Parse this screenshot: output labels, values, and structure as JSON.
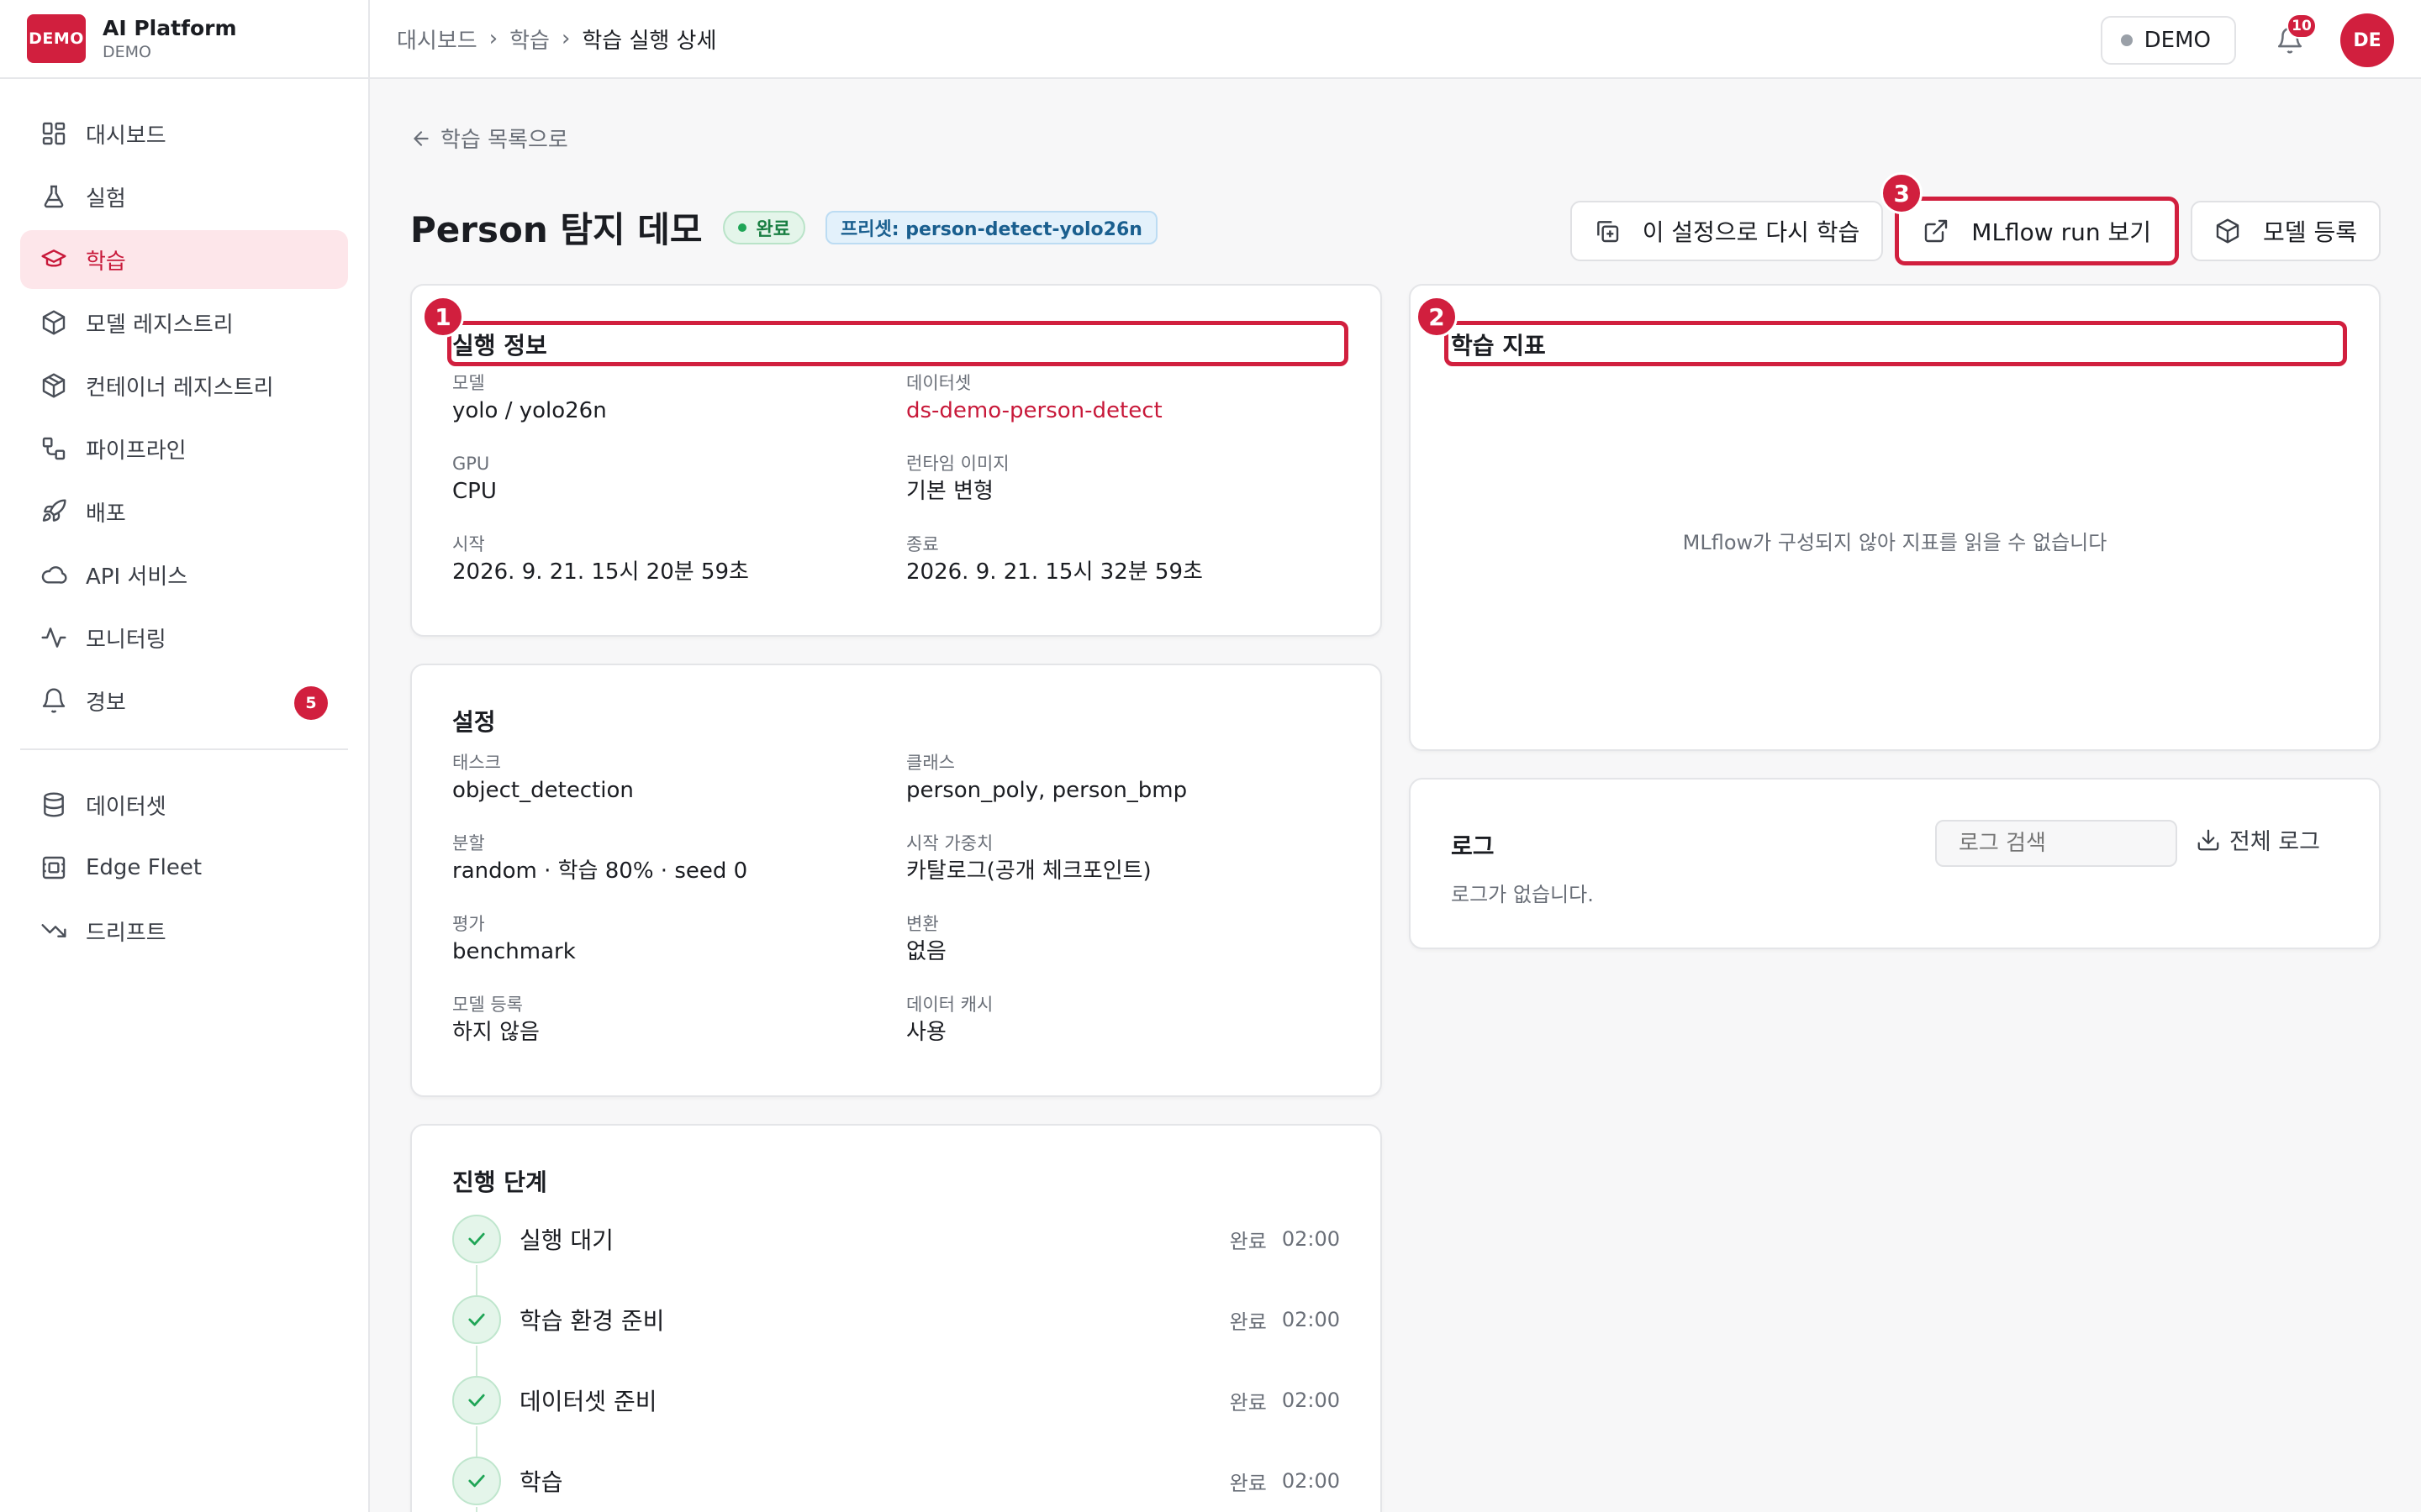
{
  "brand": {
    "logo": "DEMO",
    "name": "AI Platform",
    "sub": "DEMO"
  },
  "sidebar": {
    "items": [
      {
        "label": "대시보드",
        "icon": "dashboard-icon"
      },
      {
        "label": "실험",
        "icon": "flask-icon"
      },
      {
        "label": "학습",
        "icon": "graduation-cap-icon",
        "active": true
      },
      {
        "label": "모델 레지스트리",
        "icon": "cube-icon"
      },
      {
        "label": "컨테이너 레지스트리",
        "icon": "container-icon"
      },
      {
        "label": "파이프라인",
        "icon": "pipeline-icon"
      },
      {
        "label": "배포",
        "icon": "rocket-icon"
      },
      {
        "label": "API 서비스",
        "icon": "cloud-icon"
      },
      {
        "label": "모니터링",
        "icon": "activity-icon"
      },
      {
        "label": "경보",
        "icon": "bell-icon",
        "badge": "5"
      }
    ],
    "items2": [
      {
        "label": "데이터셋",
        "icon": "database-icon"
      },
      {
        "label": "Edge Fleet",
        "icon": "edge-device-icon"
      },
      {
        "label": "드리프트",
        "icon": "trend-down-icon"
      }
    ]
  },
  "topbar": {
    "breadcrumb": [
      "대시보드",
      "학습",
      "학습 실행 상세"
    ],
    "env_label": "DEMO",
    "notification_count": "10",
    "avatar_initials": "DE"
  },
  "page": {
    "back_label": "학습 목록으로",
    "title": "Person 탐지 데모",
    "status": "완료",
    "preset": "프리셋: person-detect-yolo26n",
    "actions": {
      "rerun": "이 설정으로 다시 학습",
      "mlflow": "MLflow run 보기",
      "register": "모델 등록"
    },
    "markers": {
      "m1": "1",
      "m2": "2",
      "m3": "3"
    }
  },
  "run_info": {
    "title": "실행 정보",
    "fields": [
      {
        "label": "모델",
        "value": "yolo / yolo26n"
      },
      {
        "label": "데이터셋",
        "value": "ds-demo-person-detect"
      },
      {
        "label": "GPU",
        "value": "CPU"
      },
      {
        "label": "런타임 이미지",
        "value": "기본 변형"
      },
      {
        "label": "시작",
        "value": "2026. 9. 21. 15시 20분 59초"
      },
      {
        "label": "종료",
        "value": "2026. 9. 21. 15시 32분 59초"
      }
    ]
  },
  "settings": {
    "title": "설정",
    "fields": [
      {
        "label": "태스크",
        "value": "object_detection"
      },
      {
        "label": "클래스",
        "value": "person_poly, person_bmp"
      },
      {
        "label": "분할",
        "value": "random · 학습 80% · seed 0"
      },
      {
        "label": "시작 가중치",
        "value": "카탈로그(공개 체크포인트)"
      },
      {
        "label": "평가",
        "value": "benchmark"
      },
      {
        "label": "변환",
        "value": "없음"
      },
      {
        "label": "모델 등록",
        "value": "하지 않음"
      },
      {
        "label": "데이터 캐시",
        "value": "사용"
      }
    ]
  },
  "steps": {
    "title": "진행 단계",
    "items": [
      {
        "name": "실행 대기",
        "status": "완료",
        "time": "02:00"
      },
      {
        "name": "학습 환경 준비",
        "status": "완료",
        "time": "02:00"
      },
      {
        "name": "데이터셋 준비",
        "status": "완료",
        "time": "02:00"
      },
      {
        "name": "학습",
        "status": "완료",
        "time": "02:00"
      }
    ]
  },
  "metrics": {
    "title": "학습 지표",
    "empty": "MLflow가 구성되지 않아 지표를 읽을 수 없습니다"
  },
  "logs": {
    "title": "로그",
    "search_placeholder": "로그 검색",
    "download_label": "전체 로그",
    "empty": "로그가 없습니다."
  },
  "colors": {
    "accent": "#d11f3e",
    "success": "#1fa556",
    "link": "#c8193a"
  }
}
